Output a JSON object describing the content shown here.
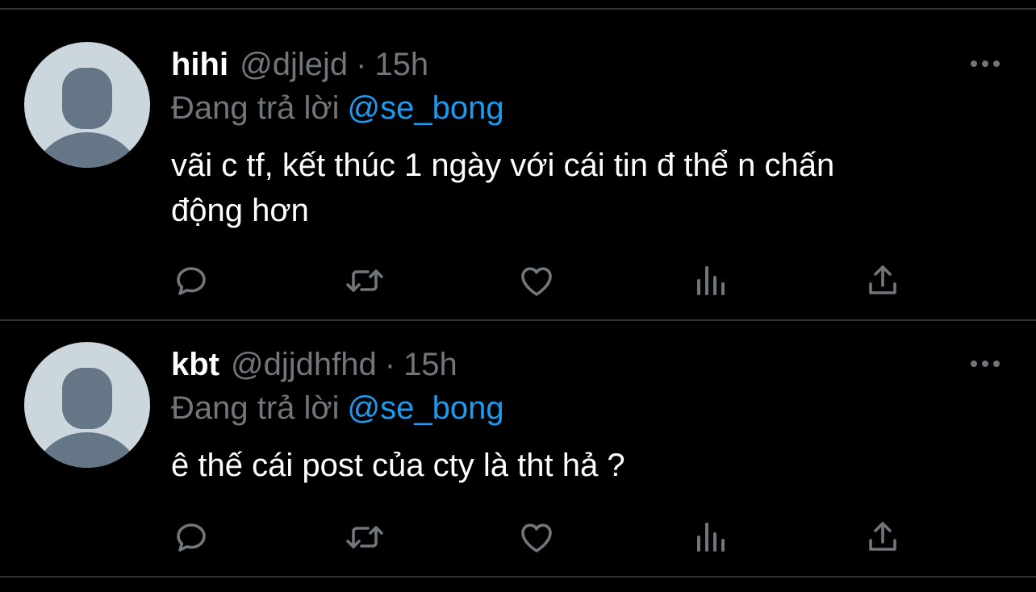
{
  "colors": {
    "background": "#000000",
    "divider": "#2f3336",
    "text_primary": "#ffffff",
    "text_secondary": "#71767b",
    "link": "#1d9bf0",
    "avatar_bg": "#ccd6dd",
    "avatar_fg": "#657786"
  },
  "tweets": [
    {
      "name": "hihi",
      "handle": "@djlejd",
      "separator": "·",
      "time": "15h",
      "replying_prefix": "Đang trả lời",
      "replying_to": "@se_bong",
      "text_lines": [
        "vãi c tf, kết thúc 1 ngày với cái tin đ thể n chấn",
        "động hơn"
      ],
      "actions": [
        "reply-icon",
        "retweet-icon",
        "like-icon",
        "analytics-icon",
        "share-icon"
      ],
      "more_icon": "more-options-icon"
    },
    {
      "name": "kbt",
      "handle": "@djjdhfhd",
      "separator": "·",
      "time": "15h",
      "replying_prefix": "Đang trả lời",
      "replying_to": "@se_bong",
      "text_lines": [
        "ê thế cái post của cty là tht hả ?"
      ],
      "actions": [
        "reply-icon",
        "retweet-icon",
        "like-icon",
        "analytics-icon",
        "share-icon"
      ],
      "more_icon": "more-options-icon"
    }
  ]
}
